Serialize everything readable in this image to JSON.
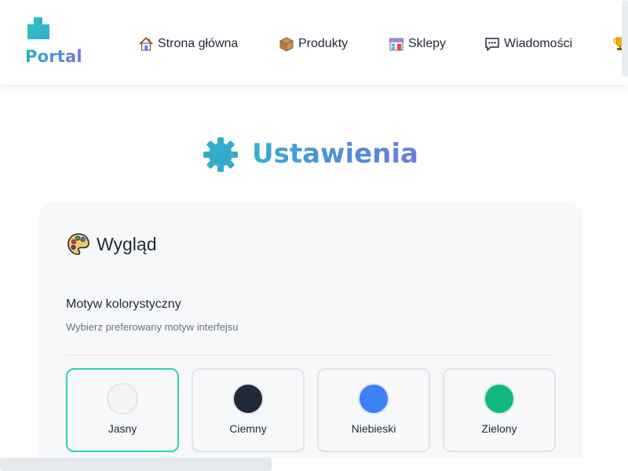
{
  "header": {
    "logo_text": "Portal",
    "nav": [
      {
        "label": "Strona główna",
        "icon": "house-icon"
      },
      {
        "label": "Produkty",
        "icon": "box-icon"
      },
      {
        "label": "Sklepy",
        "icon": "shop-icon"
      },
      {
        "label": "Wiadomości",
        "icon": "message-icon"
      },
      {
        "label": "",
        "icon": "trophy-icon"
      }
    ]
  },
  "page": {
    "title": "Ustawienia",
    "title_icon": "gear-icon"
  },
  "appearance": {
    "section_title": "Wygląd",
    "section_icon": "palette-icon",
    "theme_label": "Motyw kolorystyczny",
    "theme_description": "Wybierz preferowany motyw interfejsu",
    "selected_theme": "Jasny",
    "themes": [
      {
        "label": "Jasny",
        "color": "#f3f4f6"
      },
      {
        "label": "Ciemny",
        "color": "#1f2937"
      },
      {
        "label": "Niebieski",
        "color": "#3b82f6"
      },
      {
        "label": "Zielony",
        "color": "#10b981"
      }
    ]
  },
  "colors": {
    "accent": "#2dd4b4",
    "brand_gradient_start": "#2bb3c0",
    "brand_gradient_end": "#7b6fe0"
  }
}
